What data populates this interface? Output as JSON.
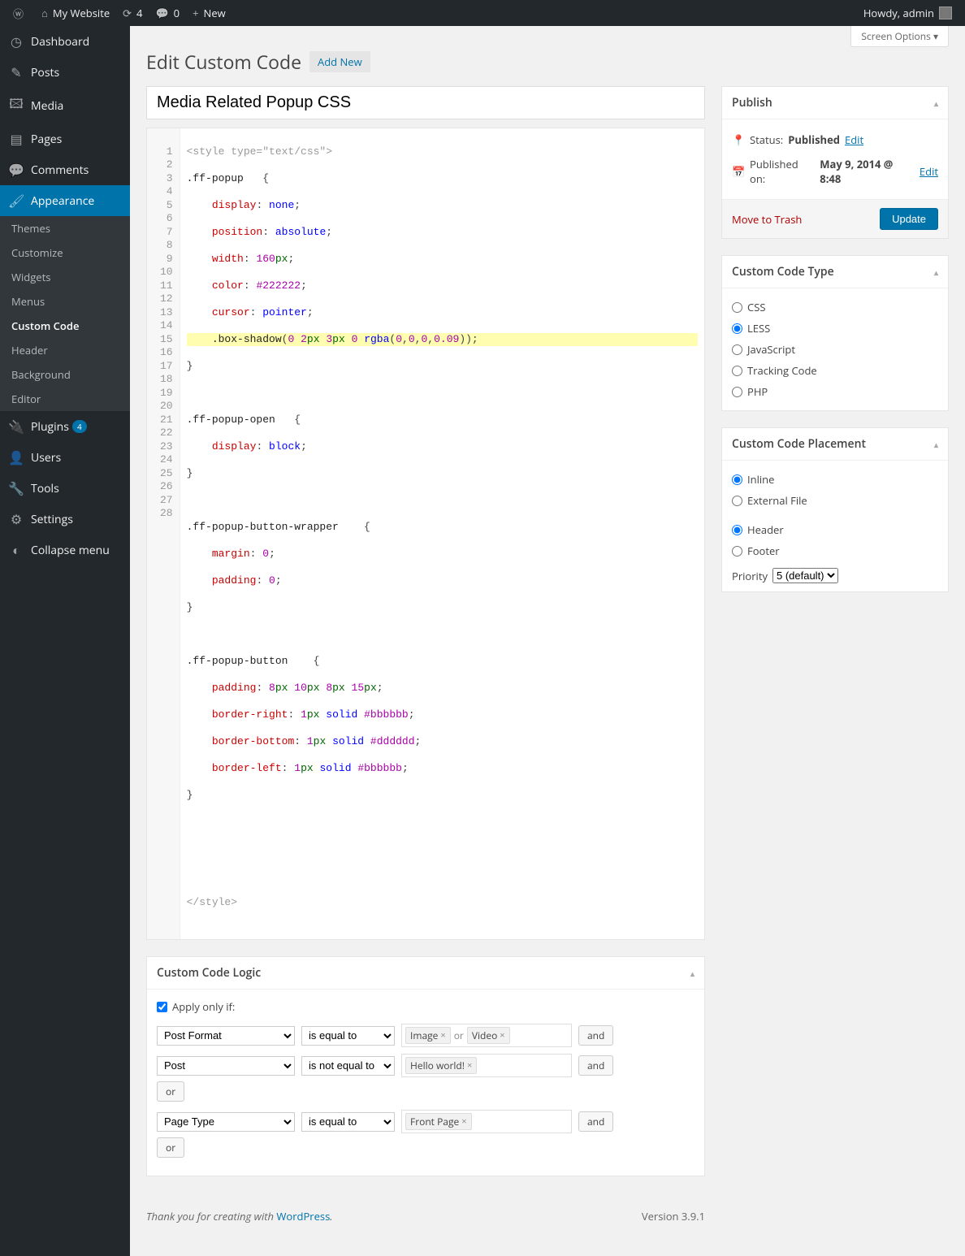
{
  "adminbar": {
    "site_name": "My Website",
    "updates": "4",
    "comments": "0",
    "new": "New",
    "howdy": "Howdy, admin"
  },
  "menu": {
    "items": [
      {
        "icon": "◷",
        "label": "Dashboard"
      },
      {
        "icon": "✎",
        "label": "Posts"
      },
      {
        "icon": "🖾",
        "label": "Media"
      },
      {
        "icon": "▤",
        "label": "Pages"
      },
      {
        "icon": "💬",
        "label": "Comments"
      },
      {
        "icon": "🖌",
        "label": "Appearance",
        "current": true
      },
      {
        "icon": "🔌",
        "label": "Plugins",
        "badge": "4"
      },
      {
        "icon": "👤",
        "label": "Users"
      },
      {
        "icon": "🔧",
        "label": "Tools"
      },
      {
        "icon": "⚙",
        "label": "Settings"
      },
      {
        "icon": "◐",
        "label": "Collapse menu"
      }
    ],
    "submenu": [
      "Themes",
      "Customize",
      "Widgets",
      "Menus",
      "Custom Code",
      "Header",
      "Background",
      "Editor"
    ],
    "submenu_active": "Custom Code"
  },
  "screen_options": "Screen Options",
  "page": {
    "title": "Edit Custom Code",
    "add_new": "Add New",
    "post_title": "Media Related Popup CSS"
  },
  "code": {
    "open_tag": "<style type=\"text/css\">",
    "close_tag": "</style>",
    "lines": 28
  },
  "publish": {
    "heading": "Publish",
    "status_label": "Status:",
    "status_value": "Published",
    "edit": "Edit",
    "published_label": "Published on:",
    "published_value": "May 9, 2014 @ 8:48",
    "trash": "Move to Trash",
    "update": "Update"
  },
  "code_type": {
    "heading": "Custom Code Type",
    "options": [
      "CSS",
      "LESS",
      "JavaScript",
      "Tracking Code",
      "PHP"
    ],
    "selected": "LESS"
  },
  "placement": {
    "heading": "Custom Code Placement",
    "group1": [
      "Inline",
      "External File"
    ],
    "group1_selected": "Inline",
    "group2": [
      "Header",
      "Footer"
    ],
    "group2_selected": "Header",
    "priority_label": "Priority",
    "priority_value": "5 (default)"
  },
  "logic": {
    "heading": "Custom Code Logic",
    "apply_label": "Apply only if:",
    "rules": [
      {
        "field": "Post Format",
        "op": "is equal to",
        "tags": [
          "Image",
          "Video"
        ],
        "join": "and"
      },
      {
        "field": "Post",
        "op": "is not equal to",
        "tags": [
          "Hello world!"
        ],
        "join": "and"
      }
    ],
    "or": "or",
    "rules2": [
      {
        "field": "Page Type",
        "op": "is equal to",
        "tags": [
          "Front Page"
        ],
        "join": "and"
      }
    ]
  },
  "footer": {
    "thanks_pre": "Thank you for creating with ",
    "wp": "WordPress",
    "version": "Version 3.9.1"
  }
}
